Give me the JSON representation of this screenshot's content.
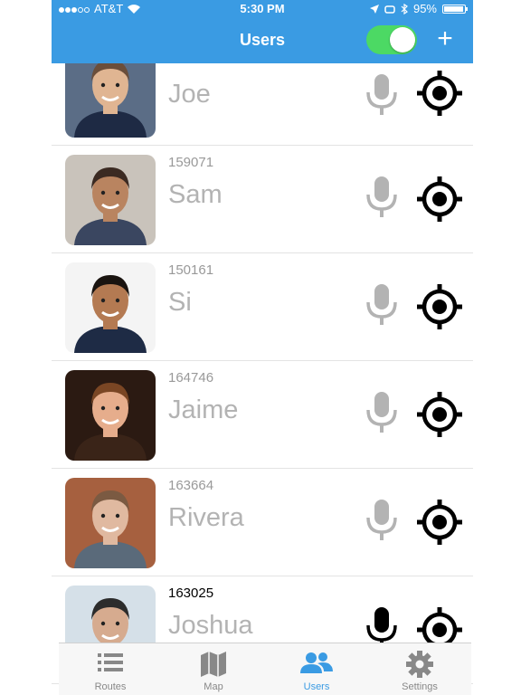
{
  "status_bar": {
    "carrier": "AT&T",
    "time": "5:30 PM",
    "battery": "95%"
  },
  "nav": {
    "title": "Users",
    "add_label": "+",
    "toggle_on": true
  },
  "users": [
    {
      "id": "",
      "name": "Joe",
      "mic_active": false,
      "avatar_bg": "#5b6d86",
      "skin": "#e0b592",
      "hair": "#6b4e3a",
      "shirt": "#1e2a44"
    },
    {
      "id": "159071",
      "name": "Sam",
      "mic_active": false,
      "avatar_bg": "#c9c3bb",
      "skin": "#b98460",
      "hair": "#3b2a22",
      "shirt": "#3a4660"
    },
    {
      "id": "150161",
      "name": "Si",
      "mic_active": false,
      "avatar_bg": "#f4f4f4",
      "skin": "#b47a52",
      "hair": "#1a1410",
      "shirt": "#1e2b45"
    },
    {
      "id": "164746",
      "name": "Jaime",
      "mic_active": false,
      "avatar_bg": "#2b1a12",
      "skin": "#e6ad8c",
      "hair": "#7a4624",
      "shirt": "#3a2418"
    },
    {
      "id": "163664",
      "name": "Rivera",
      "mic_active": false,
      "avatar_bg": "#a6603f",
      "skin": "#e0b9a0",
      "hair": "#7b5a42",
      "shirt": "#5a6a7a"
    },
    {
      "id": "163025",
      "name": "Joshua",
      "mic_active": true,
      "avatar_bg": "#d5e0e8",
      "skin": "#d6ab8f",
      "hair": "#2c2c2c",
      "shirt": "#3a4a5a"
    }
  ],
  "tabs": [
    {
      "label": "Routes",
      "icon": "list-icon",
      "active": false
    },
    {
      "label": "Map",
      "icon": "map-icon",
      "active": false
    },
    {
      "label": "Users",
      "icon": "users-icon",
      "active": true
    },
    {
      "label": "Settings",
      "icon": "gear-icon",
      "active": false
    }
  ],
  "colors": {
    "header": "#3a9be3",
    "toggle": "#4cd964",
    "mic_inactive": "#b3b3b3",
    "mic_active": "#000000",
    "tab_active": "#3a9be3",
    "tab_inactive": "#888888"
  }
}
